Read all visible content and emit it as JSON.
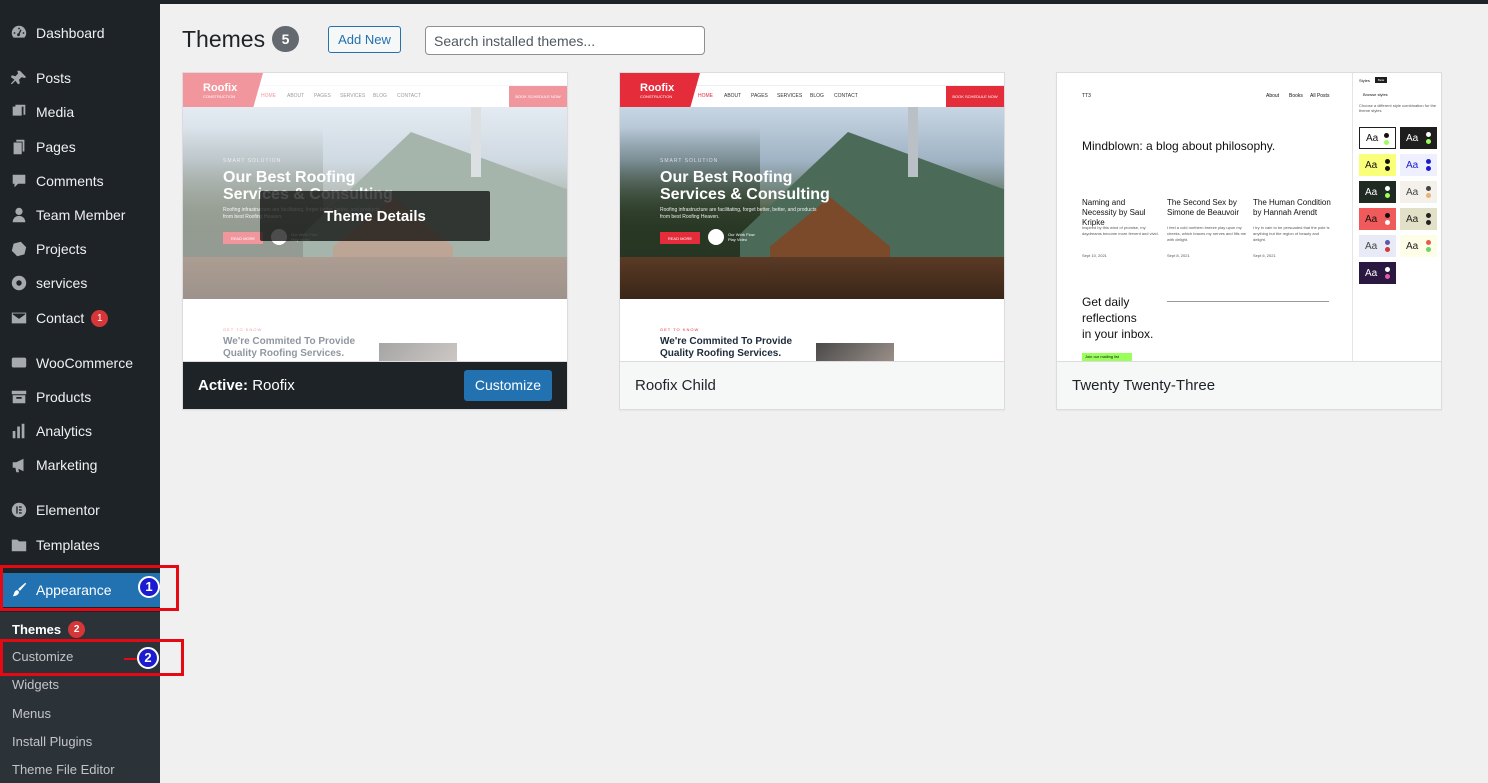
{
  "sidebar": {
    "items": [
      {
        "label": "Dashboard",
        "icon": "dashboard-icon"
      },
      {
        "label": "Posts",
        "icon": "pin-icon"
      },
      {
        "label": "Media",
        "icon": "media-icon"
      },
      {
        "label": "Pages",
        "icon": "pages-icon"
      },
      {
        "label": "Comments",
        "icon": "comments-icon"
      },
      {
        "label": "Team Member",
        "icon": "user-icon"
      },
      {
        "label": "Projects",
        "icon": "portfolio-icon"
      },
      {
        "label": "services",
        "icon": "gear-icon"
      },
      {
        "label": "Contact",
        "icon": "mail-icon",
        "badge": "1"
      },
      {
        "label": "WooCommerce",
        "icon": "woo-icon"
      },
      {
        "label": "Products",
        "icon": "archive-icon"
      },
      {
        "label": "Analytics",
        "icon": "bar-chart-icon"
      },
      {
        "label": "Marketing",
        "icon": "megaphone-icon"
      },
      {
        "label": "Elementor",
        "icon": "elementor-icon"
      },
      {
        "label": "Templates",
        "icon": "folder-icon"
      },
      {
        "label": "Appearance",
        "icon": "paintbrush-icon"
      }
    ],
    "submenu": [
      {
        "label": "Themes",
        "badge": "2"
      },
      {
        "label": "Customize"
      },
      {
        "label": "Widgets"
      },
      {
        "label": "Menus"
      },
      {
        "label": "Install Plugins"
      },
      {
        "label": "Theme File Editor"
      }
    ],
    "steps": [
      "1",
      "2"
    ]
  },
  "header": {
    "title": "Themes",
    "count": "5",
    "add_new": "Add New",
    "search_placeholder": "Search installed themes..."
  },
  "themes": [
    {
      "name": "Roofix",
      "active_prefix": "Active:",
      "details": "Theme Details",
      "customize": "Customize",
      "preview": {
        "logo": "Roofix",
        "logo_sub": "CONSTRUCTION",
        "menu": [
          "HOME",
          "ABOUT",
          "PAGES",
          "SERVICES",
          "BLOG",
          "CONTACT"
        ],
        "cta": "BOOK SCHEDULE NOW",
        "kicker": "SMART SOLUTION",
        "headline_1": "Our Best Roofing",
        "headline_2": "Services & Consulting",
        "paragraph": "Roofing infrastructure are facilitating, forget better, better, and products from best Roofing Heaven.",
        "button": "READ MORE",
        "play_1": "Our Work Flow",
        "play_2": "Play Video",
        "lower_kicker": "GET TO KNOW",
        "lower_h1": "We're Commited To Provide",
        "lower_h2": "Quality Roofing Services."
      }
    },
    {
      "name": "Roofix Child",
      "preview": {
        "logo": "Roofix",
        "logo_sub": "CONSTRUCTION",
        "menu": [
          "HOME",
          "ABOUT",
          "PAGES",
          "SERVICES",
          "BLOG",
          "CONTACT"
        ],
        "cta": "BOOK SCHEDULE NOW",
        "kicker": "SMART SOLUTION",
        "headline_1": "Our Best Roofing",
        "headline_2": "Services & Consulting",
        "paragraph": "Roofing infrastructure are facilitating, forget better, better, and products from best Roofing Heaven.",
        "button": "READ MORE",
        "play_1": "Our Work Flow",
        "play_2": "Play Video",
        "lower_kicker": "GET TO KNOW",
        "lower_h1": "We're Commited To Provide",
        "lower_h2": "Quality Roofing Services."
      }
    },
    {
      "name": "Twenty Twenty-Three",
      "preview": {
        "logo": "TT3",
        "nav": [
          "About",
          "Books",
          "All Posts"
        ],
        "headline": "Mindblown: a blog about philosophy.",
        "posts": [
          {
            "title": "Naming and Necessity by Saul Kripke",
            "excerpt": "Inspired by this wind of promise, my daydreams become more fervent and vivid.",
            "date": "Sept 10, 2021"
          },
          {
            "title": "The Second Sex by Simone de Beauvoir",
            "excerpt": "I feel a cold northern breeze play upon my cheeks, which braces my nerves and fills me with delight.",
            "date": "Sept 8, 2021"
          },
          {
            "title": "The Human Condition by Hannah Arendt",
            "excerpt": "I try in vain to be persuaded that the pole is anything but the region of beauty and delight.",
            "date": "Sept 6, 2021"
          }
        ],
        "newsletter_1": "Get daily",
        "newsletter_2": "reflections",
        "newsletter_3": "in your inbox.",
        "join": "Join our mailing list",
        "panel_title": "Styles",
        "panel_beta": "Beta",
        "panel_sub": "Browse styles",
        "panel_desc": "Choose a different style combination for the theme styles",
        "swatch_label": "Aa"
      }
    }
  ],
  "colors": {
    "sidebar_bg": "#1d2327",
    "accent": "#2271b1",
    "badge_red": "#d63638",
    "callout_red": "#e50914",
    "step_blue": "#1b1bd1",
    "roofix_red": "#e42c3b"
  }
}
